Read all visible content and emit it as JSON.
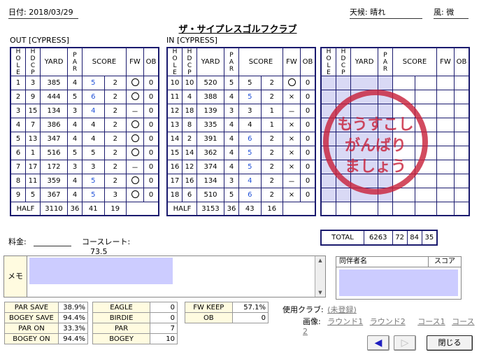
{
  "header": {
    "date": "日付: 2018/03/29",
    "weather": "天候: 晴れ",
    "wind": "風: 微",
    "course": "ザ・サイプレスゴルフクラブ"
  },
  "out": {
    "label": "OUT [CYPRESS]",
    "rows": [
      [
        "1",
        "3",
        "385",
        "4",
        "5",
        "2",
        "○",
        "0"
      ],
      [
        "2",
        "9",
        "444",
        "5",
        "6",
        "2",
        "○",
        "0"
      ],
      [
        "3",
        "15",
        "134",
        "3",
        "4",
        "2",
        "－",
        "0"
      ],
      [
        "4",
        "7",
        "386",
        "4",
        "4",
        "2",
        "○",
        "0"
      ],
      [
        "5",
        "13",
        "347",
        "4",
        "4",
        "2",
        "○",
        "0"
      ],
      [
        "6",
        "1",
        "516",
        "5",
        "5",
        "2",
        "○",
        "0"
      ],
      [
        "7",
        "17",
        "172",
        "3",
        "3",
        "2",
        "－",
        "0"
      ],
      [
        "8",
        "11",
        "359",
        "4",
        "5",
        "2",
        "○",
        "0"
      ],
      [
        "9",
        "5",
        "367",
        "4",
        "5",
        "3",
        "○",
        "0"
      ]
    ],
    "half": [
      "HALF",
      "3110",
      "36",
      "41",
      "19"
    ]
  },
  "in": {
    "label": "IN [CYPRESS]",
    "rows": [
      [
        "10",
        "10",
        "520",
        "5",
        "5",
        "2",
        "○",
        "0"
      ],
      [
        "11",
        "4",
        "388",
        "4",
        "5",
        "2",
        "×",
        "0"
      ],
      [
        "12",
        "18",
        "139",
        "3",
        "3",
        "1",
        "－",
        "0"
      ],
      [
        "13",
        "8",
        "335",
        "4",
        "4",
        "1",
        "×",
        "0"
      ],
      [
        "14",
        "2",
        "391",
        "4",
        "6",
        "2",
        "×",
        "0"
      ],
      [
        "15",
        "14",
        "362",
        "4",
        "5",
        "2",
        "×",
        "0"
      ],
      [
        "16",
        "12",
        "374",
        "4",
        "5",
        "2",
        "×",
        "0"
      ],
      [
        "17",
        "16",
        "134",
        "3",
        "4",
        "2",
        "－",
        "0"
      ],
      [
        "18",
        "6",
        "510",
        "5",
        "6",
        "2",
        "×",
        "0"
      ]
    ],
    "half": [
      "HALF",
      "3153",
      "36",
      "43",
      "16"
    ]
  },
  "headers": {
    "hole": "HOLE",
    "hdcp": "HDCP",
    "yard": "YARD",
    "par": "PAR",
    "score": "SCORE",
    "fw": "FW",
    "ob": "OB"
  },
  "total": [
    "TOTAL",
    "6263",
    "72",
    "84",
    "35"
  ],
  "stamp": [
    "もうすこし",
    "がんばり",
    "ましょう"
  ],
  "fee": "料金:",
  "rating_label": "コースレート:",
  "rating": "73.5",
  "memo_label": "メモ",
  "companions": {
    "name": "同伴者名",
    "score": "スコア"
  },
  "stats1": [
    [
      "PAR SAVE",
      "38.9%"
    ],
    [
      "BOGEY SAVE",
      "94.4%"
    ],
    [
      "PAR ON",
      "33.3%"
    ],
    [
      "BOGEY ON",
      "94.4%"
    ]
  ],
  "stats2": [
    [
      "EAGLE",
      "0"
    ],
    [
      "BIRDIE",
      "0"
    ],
    [
      "PAR",
      "7"
    ],
    [
      "BOGEY",
      "10"
    ]
  ],
  "stats3": [
    [
      "FW KEEP",
      "57.1%"
    ],
    [
      "OB",
      "0"
    ]
  ],
  "club": {
    "label": "使用クラブ:",
    "value": "(未登録)"
  },
  "image": {
    "label": "画像:",
    "r1": "ラウンド1",
    "r2": "ラウンド2",
    "c1": "コース1",
    "c2": "コース2"
  },
  "close_label": "閉じる",
  "colors": {
    "table_border": "#1a1a6e",
    "stamp_red": "#c9243d",
    "score_blue": "#1f50d8",
    "input_fill": "#ccccff",
    "label_fill": "#fffbe0"
  }
}
